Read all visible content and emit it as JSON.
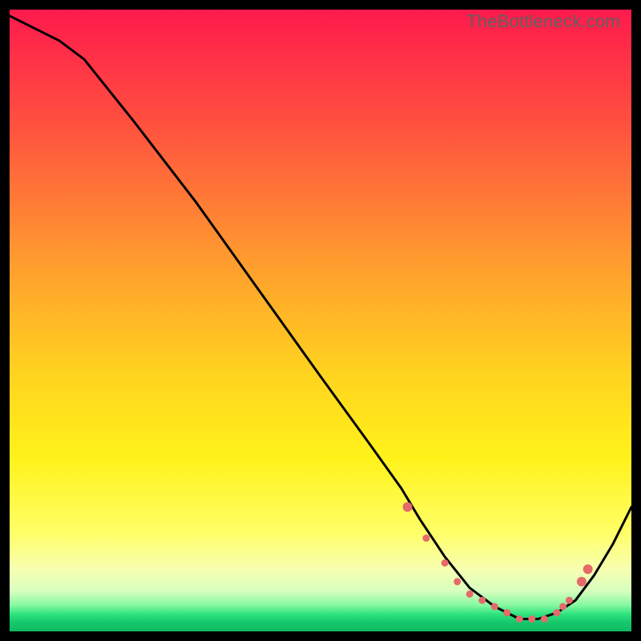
{
  "watermark": "TheBottleneck.com",
  "colors": {
    "frame": "#000000",
    "curve": "#000000",
    "marker": "#e56a6a",
    "gradient_stops": [
      {
        "offset": 0.0,
        "color": "#ff1a4d"
      },
      {
        "offset": 0.18,
        "color": "#ff4f3f"
      },
      {
        "offset": 0.4,
        "color": "#ff9a2f"
      },
      {
        "offset": 0.58,
        "color": "#ffd21f"
      },
      {
        "offset": 0.72,
        "color": "#fff21a"
      },
      {
        "offset": 0.84,
        "color": "#ffff66"
      },
      {
        "offset": 0.9,
        "color": "#f7ffb0"
      },
      {
        "offset": 0.935,
        "color": "#d8ffc0"
      },
      {
        "offset": 0.958,
        "color": "#86f8a0"
      },
      {
        "offset": 0.972,
        "color": "#2fe47f"
      },
      {
        "offset": 0.985,
        "color": "#16c96c"
      },
      {
        "offset": 1.0,
        "color": "#0fb861"
      }
    ]
  },
  "chart_data": {
    "type": "line",
    "title": "",
    "xlabel": "",
    "ylabel": "",
    "xlim": [
      0,
      100
    ],
    "ylim": [
      0,
      100
    ],
    "series": [
      {
        "name": "bottleneck-curve",
        "x": [
          0,
          4,
          8,
          12,
          20,
          30,
          40,
          50,
          58,
          63,
          66,
          70,
          74,
          78,
          82,
          85,
          88,
          91,
          94,
          97,
          100
        ],
        "y": [
          99,
          97,
          95,
          92,
          82,
          69,
          55,
          41,
          30,
          23,
          18,
          12,
          7,
          4,
          2,
          2,
          3,
          5,
          9,
          14,
          20
        ]
      }
    ],
    "markers": {
      "name": "highlight-points",
      "x": [
        64,
        67,
        70,
        72,
        74,
        76,
        78,
        80,
        82,
        84,
        86,
        88,
        89,
        90,
        92,
        93
      ],
      "y": [
        20,
        15,
        11,
        8,
        6,
        5,
        4,
        3,
        2,
        2,
        2,
        3,
        4,
        5,
        8,
        10
      ]
    }
  }
}
